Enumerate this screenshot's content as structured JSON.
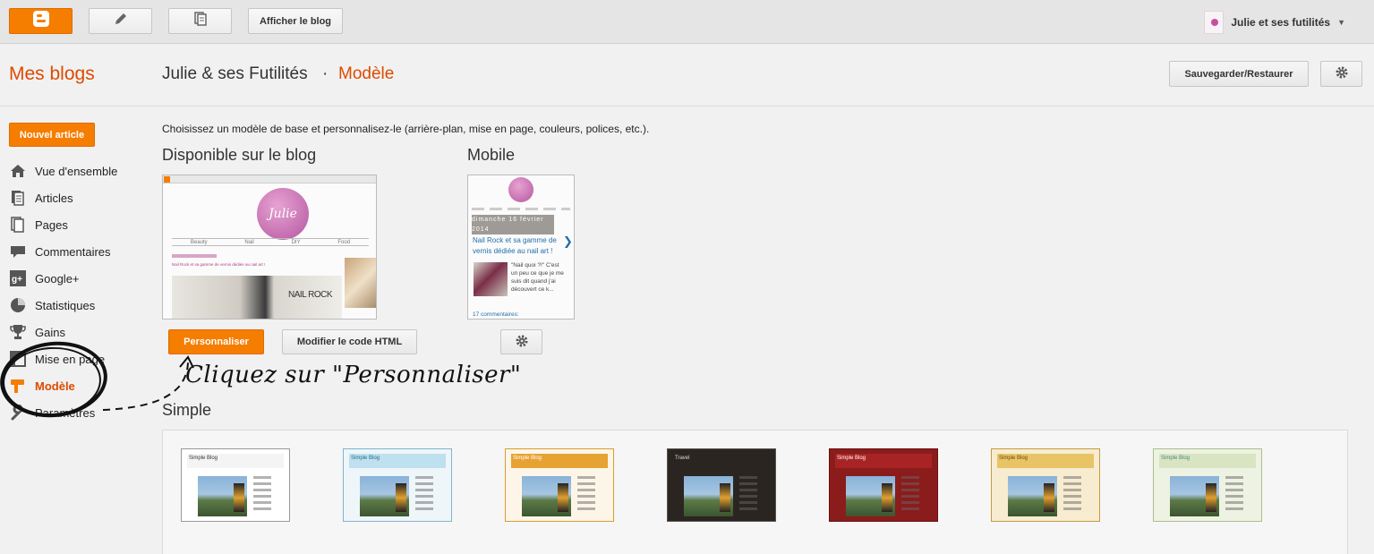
{
  "topbar": {
    "view_blog_label": "Afficher le blog",
    "user_name": "Julie et ses futilités",
    "brand_color": "#f57d00"
  },
  "header": {
    "my_blogs": "Mes blogs",
    "blog_title": "Julie & ses Futilités",
    "separator": "·",
    "section": "Modèle",
    "backup_label": "Sauvegarder/Restaurer"
  },
  "sidebar": {
    "new_post_label": "Nouvel article",
    "items": [
      {
        "label": "Vue d'ensemble",
        "icon": "home-icon"
      },
      {
        "label": "Articles",
        "icon": "posts-icon"
      },
      {
        "label": "Pages",
        "icon": "pages-icon"
      },
      {
        "label": "Commentaires",
        "icon": "comments-icon"
      },
      {
        "label": "Google+",
        "icon": "google-plus-icon"
      },
      {
        "label": "Statistiques",
        "icon": "stats-icon"
      },
      {
        "label": "Gains",
        "icon": "trophy-icon"
      },
      {
        "label": "Mise en page",
        "icon": "layout-icon"
      },
      {
        "label": "Modèle",
        "icon": "template-brush-icon",
        "active": true
      },
      {
        "label": "Paramètres",
        "icon": "wrench-icon"
      }
    ]
  },
  "main": {
    "intro": "Choisissez un modèle de base et personnalisez-le (arrière-plan, mise en page, couleurs, polices, etc.).",
    "live_heading": "Disponible sur le blog",
    "mobile_heading": "Mobile",
    "customize_label": "Personnaliser",
    "edit_html_label": "Modifier le code HTML",
    "live_preview": {
      "blog_logo_text": "Julie",
      "menu": [
        "Beauty",
        "Nail",
        "DIY",
        "Food"
      ],
      "post_title": "Nail Rock et sa gamme de vernis dédiée au nail art !",
      "brand_text": "NAIL ROCK"
    },
    "mobile_preview": {
      "date": "dimanche 16 février 2014",
      "post_title": "Nail Rock et sa gamme de vernis dédiée au nail art !",
      "excerpt": "\"Nail quoi ?!\" C'est un peu ce que je me suis dit quand j'ai découvert ce k...",
      "comments": "17 commentaires:"
    },
    "annotation": "Cliquez sur \"Personnaliser\"",
    "simple_heading": "Simple",
    "templates": [
      {
        "header": "Simple Blog",
        "bg": "#ffffff",
        "hdr_bg": "#f4f4f4",
        "hdr_color": "#333333",
        "border": "#999999"
      },
      {
        "header": "Simple Blog",
        "bg": "#eef6f9",
        "hdr_bg": "#bfe0ee",
        "hdr_color": "#1d6b91",
        "border": "#7fb5cc"
      },
      {
        "header": "Simple Blog",
        "bg": "#fdf6e8",
        "hdr_bg": "#e6a233",
        "hdr_color": "#ffffff",
        "border": "#d99b30"
      },
      {
        "header": "Travel",
        "bg": "#2b2522",
        "hdr_bg": "#2b2522",
        "hdr_color": "#dddddd",
        "border": "#555555"
      },
      {
        "header": "Simple Blog",
        "bg": "#8b1c1c",
        "hdr_bg": "#a82424",
        "hdr_color": "#ffffff",
        "border": "#6a1010"
      },
      {
        "header": "Simple Blog",
        "bg": "#f7ecd0",
        "hdr_bg": "#e8c466",
        "hdr_color": "#6b4a12",
        "border": "#c79a40"
      },
      {
        "header": "Simple Blog",
        "bg": "#eef2e2",
        "hdr_bg": "#d8e4c2",
        "hdr_color": "#4d8a7a",
        "border": "#a9bf8c"
      }
    ]
  }
}
